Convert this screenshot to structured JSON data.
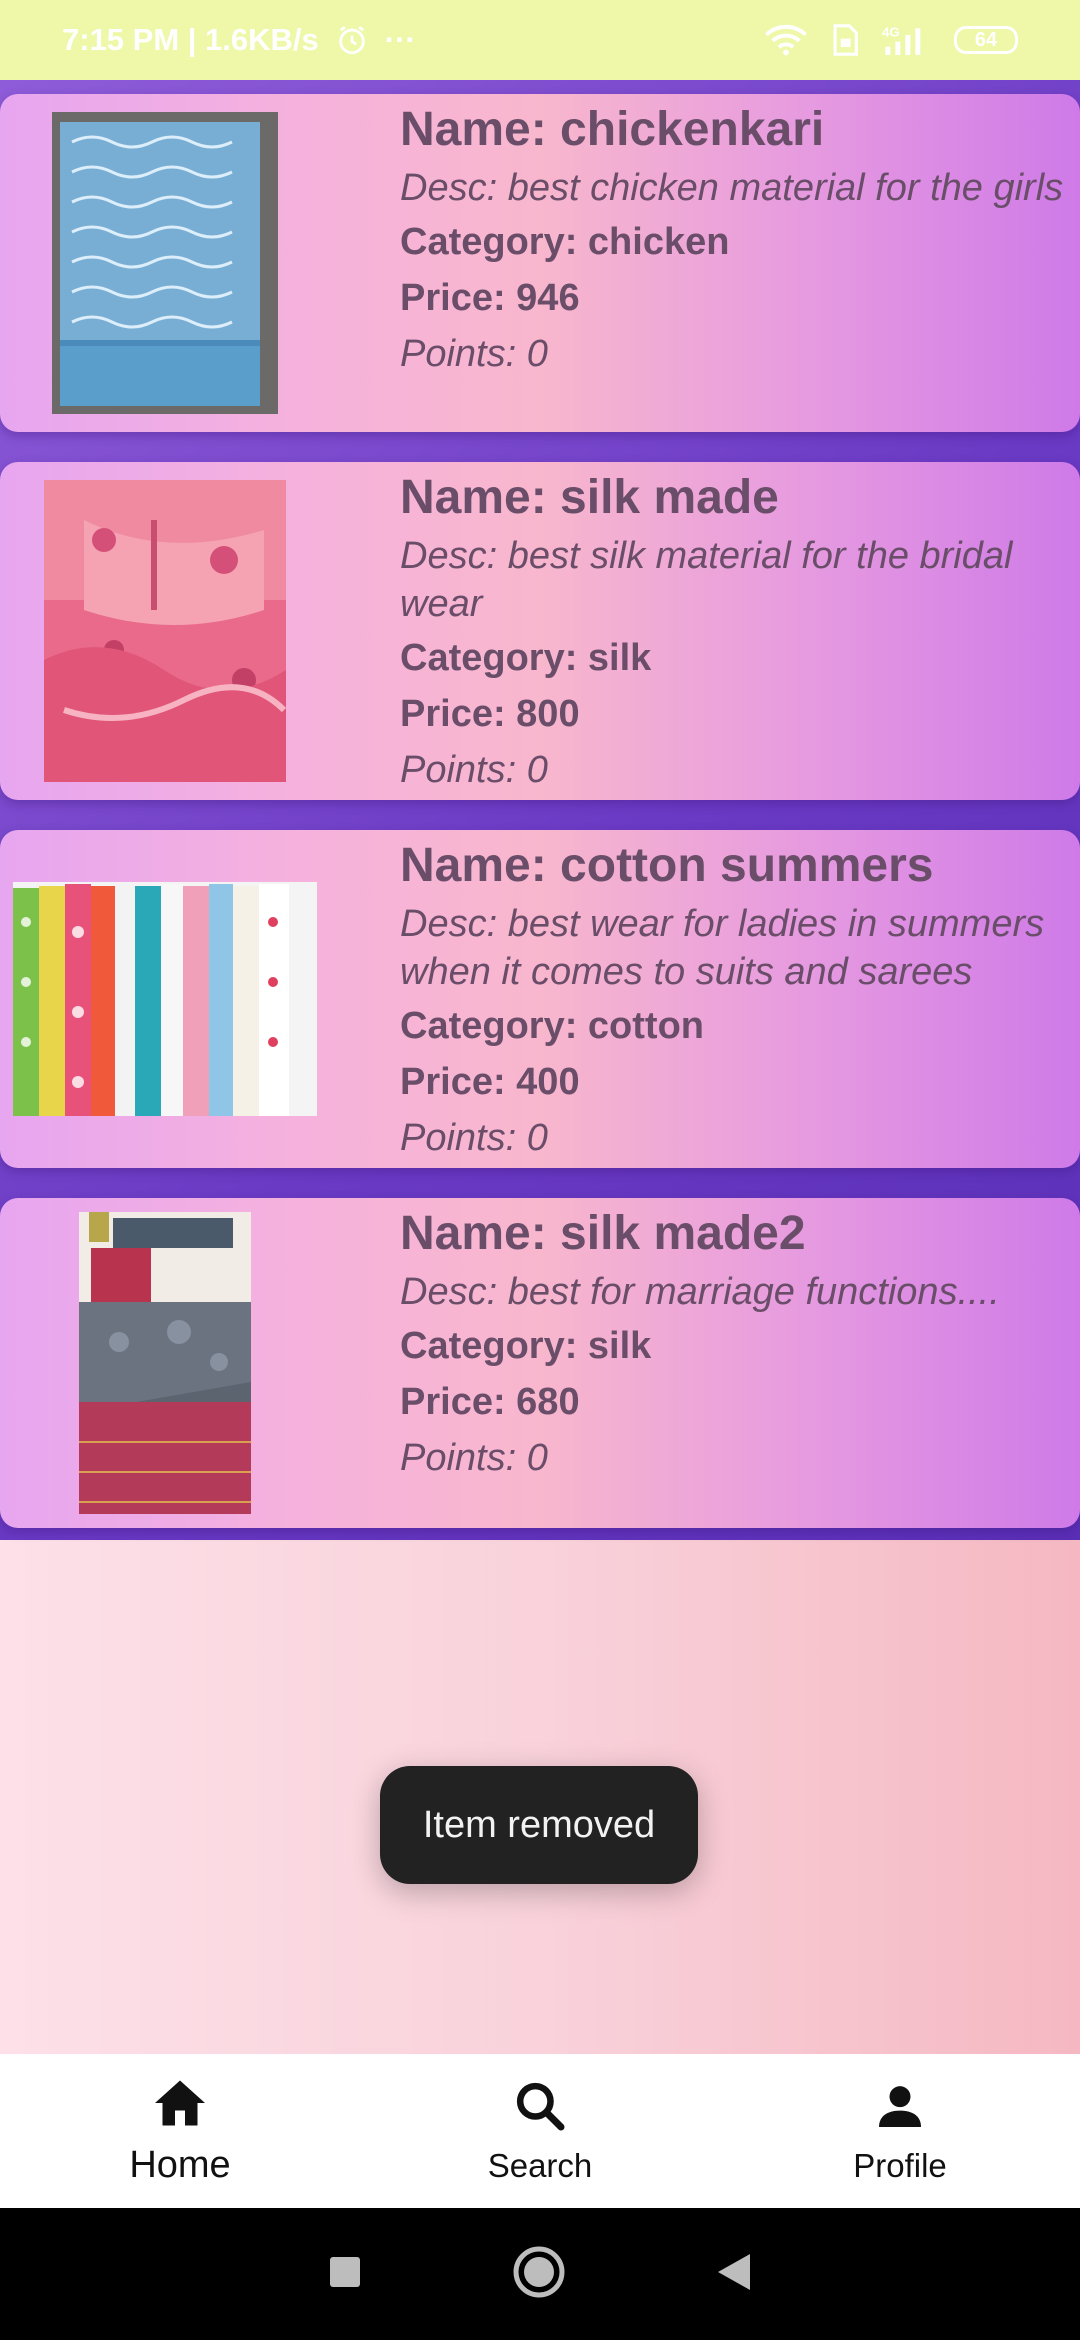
{
  "status_bar": {
    "time_speed": "7:15 PM | 1.6KB/s",
    "more": "···",
    "network": "4G",
    "battery": "64"
  },
  "products": [
    {
      "name": "Name: chickenkari",
      "desc": "Desc: best chicken material for the girls",
      "category": "Category: chicken",
      "price": "Price: 946",
      "points": "Points: 0",
      "image": "blue-chikankari-fabric"
    },
    {
      "name": "Name: silk made",
      "desc": "Desc: best silk material for the bridal wear",
      "category": "Category: silk",
      "price": "Price: 800",
      "points": "Points: 0",
      "image": "pink-embroidered-silk"
    },
    {
      "name": "Name: cotton summers",
      "desc": "Desc: best wear for ladies in summers when it comes to suits and sarees",
      "category": "Category: cotton",
      "price": "Price: 400",
      "points": "Points: 0",
      "image": "colorful-cotton-fabrics"
    },
    {
      "name": "Name: silk made2",
      "desc": "Desc: best for marriage functions....",
      "category": "Category: silk",
      "price": "Price: 680",
      "points": "Points: 0",
      "image": "red-grey-silk-saree"
    }
  ],
  "toast": {
    "message": "Item removed"
  },
  "bottom_nav": {
    "items": [
      {
        "label": "Home",
        "icon": "home-icon",
        "active": true
      },
      {
        "label": "Search",
        "icon": "search-icon",
        "active": false
      },
      {
        "label": "Profile",
        "icon": "person-icon",
        "active": false
      }
    ]
  },
  "colors": {
    "status_bar_bg": "#eef8a8",
    "list_bg": "#6a3ac4",
    "card_text": "#6a4d69",
    "toast_bg": "#222222"
  }
}
